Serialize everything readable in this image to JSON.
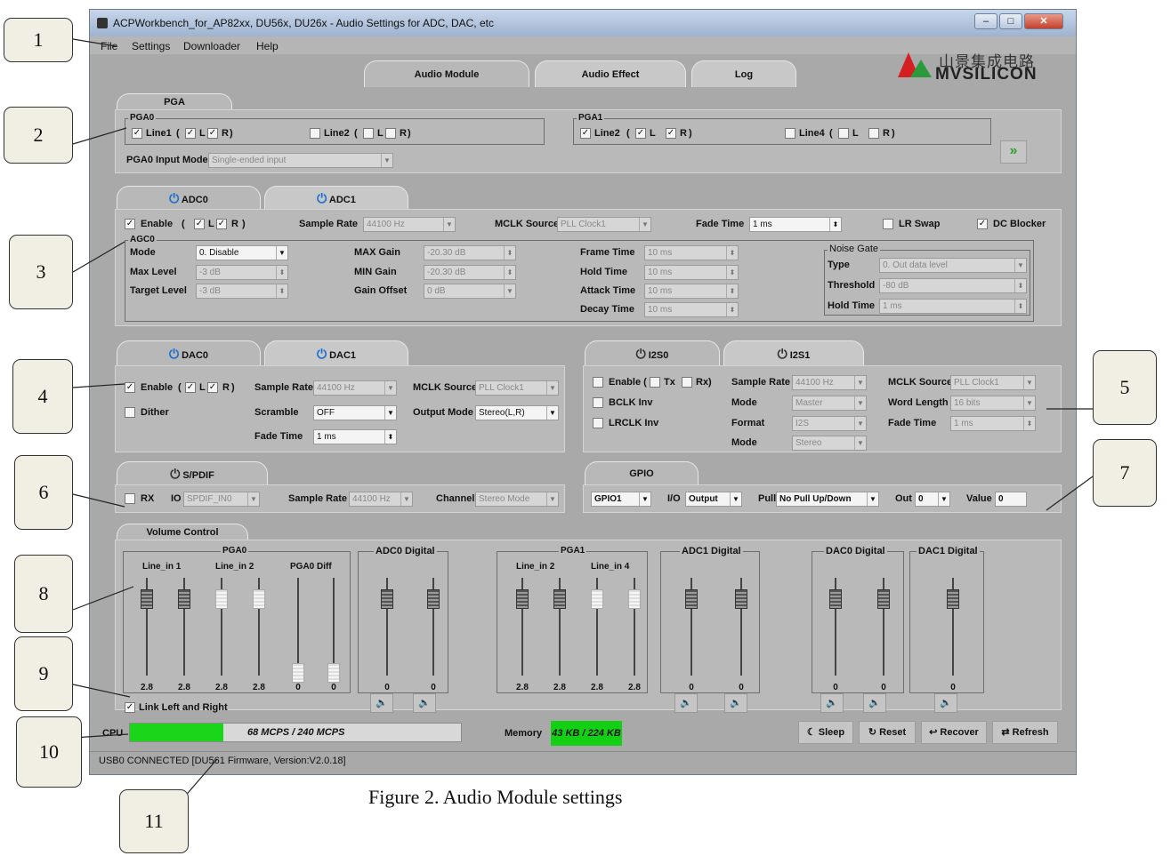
{
  "window": {
    "title": "ACPWorkbench_for_AP82xx, DU56x, DU26x - Audio Settings for ADC, DAC, etc",
    "min": "–",
    "max": "□",
    "close": "✕"
  },
  "menu": [
    "File",
    "Settings",
    "Downloader",
    "Help"
  ],
  "tabs": [
    "Audio Module",
    "Audio Effect",
    "Log"
  ],
  "logo": {
    "cn": "山景集成电路",
    "en": "MVSILICON"
  },
  "pga": {
    "tab": "PGA",
    "pga0": "PGA0",
    "pga1": "PGA1",
    "line1": "Line1",
    "line2": "Line2",
    "line4": "Line4",
    "L": "L",
    "R": "R",
    "open": "(",
    "close": ")",
    "input_mode_label": "PGA0 Input Mode",
    "input_mode_value": "Single-ended input",
    "expand": "»"
  },
  "adc": {
    "tab0": "ADC0",
    "tab1": "ADC1",
    "enable": "Enable",
    "L": "L",
    "R": "R",
    "sample_rate_label": "Sample Rate",
    "sample_rate": "44100 Hz",
    "mclk_label": "MCLK Source",
    "mclk": "PLL Clock1",
    "fade_label": "Fade Time",
    "fade": "1 ms",
    "lr_swap": "LR Swap",
    "dc_blocker": "DC Blocker",
    "agc": {
      "title": "AGC0",
      "mode_label": "Mode",
      "mode": "0. Disable",
      "max_level_label": "Max Level",
      "max_level": "-3 dB",
      "target_label": "Target Level",
      "target": "-3 dB",
      "max_gain_label": "MAX Gain",
      "max_gain": "-20.30 dB",
      "min_gain_label": "MIN Gain",
      "min_gain": "-20.30 dB",
      "offset_label": "Gain Offset",
      "offset": "0 dB",
      "frame_label": "Frame Time",
      "frame": "10 ms",
      "hold_label": "Hold   Time",
      "hold": "10 ms",
      "attack_label": "Attack Time",
      "attack": "10 ms",
      "decay_label": "Decay Time",
      "decay": "10 ms"
    },
    "noise_gate": {
      "title": "Noise Gate",
      "type_label": "Type",
      "type": "0. Out data level",
      "threshold_label": "Threshold",
      "threshold": "-80 dB",
      "hold_label": "Hold Time",
      "hold": "1 ms"
    }
  },
  "dac": {
    "tab0": "DAC0",
    "tab1": "DAC1",
    "enable": "Enable",
    "L": "L",
    "R": "R",
    "dither": "Dither",
    "sample_rate_label": "Sample Rate",
    "sample_rate": "44100 Hz",
    "scramble_label": "Scramble",
    "scramble": "OFF",
    "fade_label": "Fade Time",
    "fade": "1 ms",
    "mclk_label": "MCLK Source",
    "mclk": "PLL Clock1",
    "output_label": "Output Mode",
    "output": "Stereo(L,R)"
  },
  "i2s": {
    "tab0": "I2S0",
    "tab1": "I2S1",
    "enable": "Enable (",
    "tx": "Tx",
    "rx": "Rx)",
    "bclk": "BCLK Inv",
    "lrclk": "LRCLK Inv",
    "sample_rate_label": "Sample Rate",
    "sample_rate": "44100 Hz",
    "mode_label": "Mode",
    "mode": "Master",
    "format_label": "Format",
    "format": "I2S",
    "mode2_label": "Mode",
    "mode2": "Stereo",
    "mclk_label": "MCLK Source",
    "mclk": "PLL Clock1",
    "word_label": "Word Length",
    "word": "16 bits",
    "fade_label": "Fade Time",
    "fade": "1 ms"
  },
  "spdif": {
    "tab": "S/PDIF",
    "rx": "RX",
    "io_label": "IO",
    "io": "SPDIF_IN0",
    "sample_rate_label": "Sample Rate",
    "sample_rate": "44100 Hz",
    "channel_label": "Channel",
    "channel": "Stereo Mode"
  },
  "gpio": {
    "tab": "GPIO",
    "port": "GPIO1",
    "io_label": "I/O",
    "io": "Output",
    "pull_label": "Pull",
    "pull": "No Pull Up/Down",
    "out_label": "Out",
    "out": "0",
    "value_label": "Value",
    "value": "0"
  },
  "volume": {
    "tab": "Volume Control",
    "pga0": "PGA0",
    "line_in1": "Line_in 1",
    "line_in2": "Line_in 2",
    "pga0_diff": "PGA0 Diff",
    "adc0": "ADC0 Digital",
    "pga1": "PGA1",
    "pga1_line2": "Line_in  2",
    "pga1_line4": "Line_in 4",
    "adc1": "ADC1 Digital",
    "dac0": "DAC0 Digital",
    "dac1": "DAC1 Digital",
    "link": "Link Left and Right",
    "sliders": [
      {
        "v": "2.8",
        "level": 0.5
      },
      {
        "v": "2.8",
        "level": 0.5
      },
      {
        "v": "2.8",
        "level": 0.5
      },
      {
        "v": "2.8",
        "level": 0.5
      },
      {
        "v": "0",
        "level": 0.0
      },
      {
        "v": "0",
        "level": 0.0
      },
      {
        "v": "0",
        "level": 0.5
      },
      {
        "v": "0",
        "level": 0.5
      },
      {
        "v": "2.8",
        "level": 0.5
      },
      {
        "v": "2.8",
        "level": 0.5
      },
      {
        "v": "2.8",
        "level": 0.5
      },
      {
        "v": "2.8",
        "level": 0.5
      },
      {
        "v": "0",
        "level": 0.5
      },
      {
        "v": "0",
        "level": 0.5
      },
      {
        "v": "0",
        "level": 0.5
      },
      {
        "v": "0",
        "level": 0.5
      },
      {
        "v": "0",
        "level": 0.5
      }
    ],
    "speaker": "🔈"
  },
  "status": {
    "cpu_label": "CPU",
    "cpu_text": "68 MCPS / 240 MCPS",
    "cpu_fraction": 0.283,
    "mem_label": "Memory",
    "mem_text": "43 KB / 224 KB",
    "sleep": "Sleep",
    "reset": "Reset",
    "recover": "Recover",
    "refresh": "Refresh",
    "connection": "USB0 CONNECTED [DU561 Firmware, Version:V2.0.18]"
  },
  "callouts": [
    "1",
    "2",
    "3",
    "4",
    "5",
    "6",
    "7",
    "8",
    "9",
    "10",
    "11"
  ],
  "caption": "Figure 2. Audio Module settings"
}
